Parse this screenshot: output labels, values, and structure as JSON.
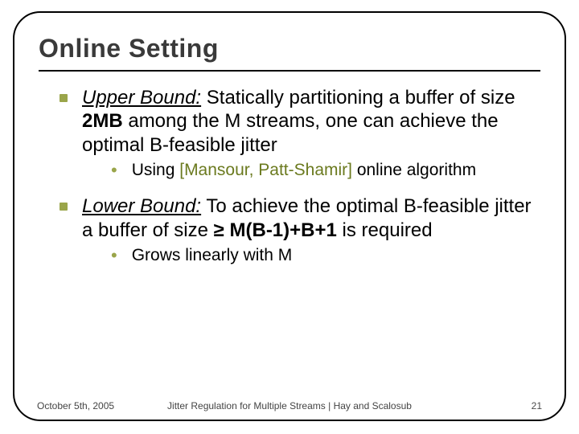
{
  "title": "Online Setting",
  "bullets": {
    "first": {
      "lead_i_u": "Upper Bound:",
      "after_lead": " Statically partitioning a buffer of size ",
      "strong_size": "2MB",
      "after_size": " among the M streams, one can achieve the optimal B-feasible jitter",
      "sub": {
        "pre": "Using ",
        "cite": "[Mansour, Patt-Shamir]",
        "post": " online algorithm"
      }
    },
    "second": {
      "lead_i_u": "Lower Bound:",
      "after_lead": " To achieve the optimal B-feasible jitter a buffer of size ",
      "strong_expr": "≥ M(B-1)+B+1",
      "after_expr": " is required",
      "sub": "Grows linearly with M"
    }
  },
  "footer": {
    "date": "October 5th, 2005",
    "center": "Jitter Regulation for Multiple Streams | Hay and Scalosub",
    "page": "21"
  }
}
